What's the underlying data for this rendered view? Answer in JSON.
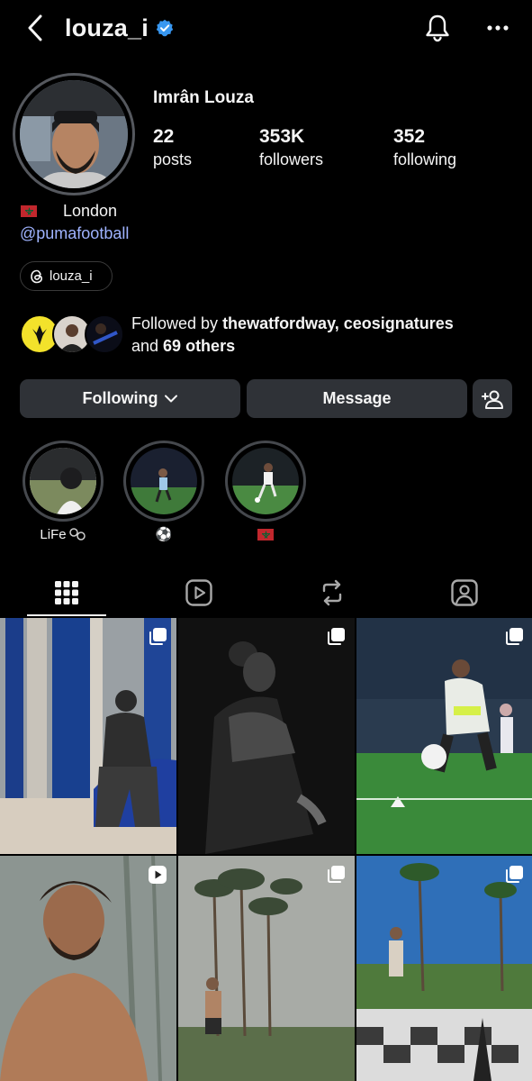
{
  "header": {
    "username": "louza_i",
    "verified": true
  },
  "profile": {
    "full_name": "Imrân Louza",
    "stats": [
      {
        "value": "22",
        "label": "posts"
      },
      {
        "value": "353K",
        "label": "followers"
      },
      {
        "value": "352",
        "label": "following"
      }
    ],
    "location": "London",
    "link": "@pumafootball",
    "threads_handle": "louza_i"
  },
  "followed_by": {
    "prefix": "Followed by ",
    "names": "thewatfordway, ceosignatures",
    "and": "and ",
    "others": "69 others"
  },
  "actions": {
    "following_label": "Following",
    "message_label": "Message"
  },
  "highlights": [
    {
      "label": "LiFe"
    },
    {
      "label": "⚽"
    },
    {
      "label": ""
    }
  ],
  "tabs": [
    "posts-grid",
    "reels",
    "reposts",
    "tagged"
  ],
  "colors": {
    "background": "#000000",
    "button": "#2f3237",
    "link": "#9fb3ff",
    "verified": "#3897f0"
  }
}
